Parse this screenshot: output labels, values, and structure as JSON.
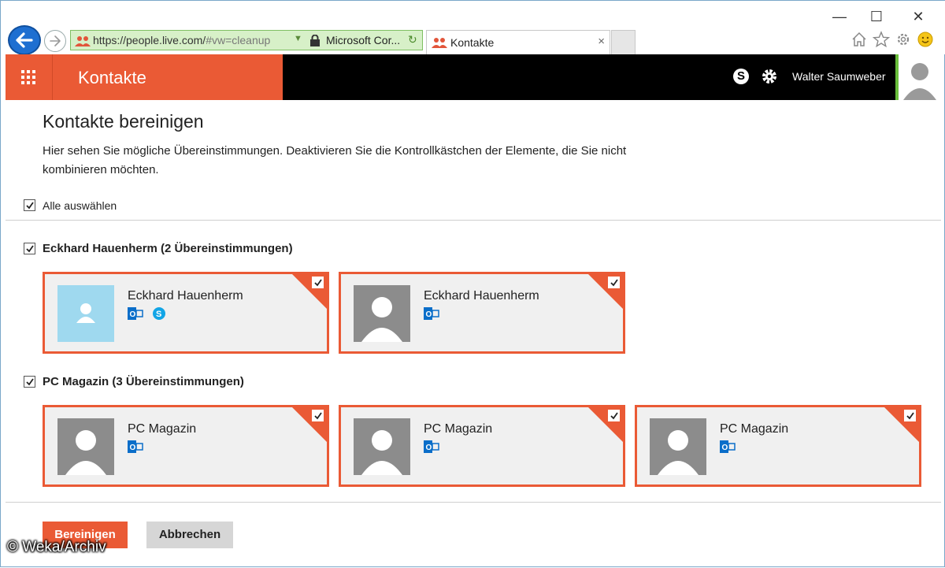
{
  "browser": {
    "url_main": "https://people.live.com/",
    "url_hash": "#vw=cleanup",
    "site_identity": "Microsoft Cor...",
    "tab_title": "Kontakte",
    "tab_close": "×",
    "window_controls": [
      "—",
      "☐",
      "✕"
    ],
    "icons": [
      "back-arrow-icon",
      "forward-arrow-icon",
      "people-icon",
      "lock-icon",
      "refresh-icon",
      "home-icon",
      "favorites-star-icon",
      "settings-gear-icon",
      "smiley-feedback-icon"
    ]
  },
  "appbar": {
    "title": "Kontakte",
    "user_name": "Walter Saumweber",
    "colors": {
      "brand": "#ea5a35",
      "bar": "#000000",
      "avatar_border": "#6abf3c"
    }
  },
  "page": {
    "title": "Kontakte bereinigen",
    "intro": "Hier sehen Sie mögliche Übereinstimmungen. Deaktivieren Sie die Kontrollkästchen der Elemente, die Sie nicht kombinieren möchten.",
    "select_all_label": "Alle auswählen",
    "select_all_checked": true
  },
  "groups": [
    {
      "label": "Eckhard Hauenherm (2 Übereinstimmungen)",
      "checked": true,
      "cards": [
        {
          "name": "Eckhard Hauenherm",
          "checked": true,
          "photo": "blue-placeholder",
          "services": [
            "outlook-icon",
            "skype-icon"
          ]
        },
        {
          "name": "Eckhard Hauenherm",
          "checked": true,
          "photo": "gray-silhouette",
          "services": [
            "outlook-icon"
          ]
        }
      ]
    },
    {
      "label": "PC Magazin (3 Übereinstimmungen)",
      "checked": true,
      "cards": [
        {
          "name": "PC Magazin",
          "checked": true,
          "photo": "gray-silhouette",
          "services": [
            "outlook-icon"
          ]
        },
        {
          "name": "PC Magazin",
          "checked": true,
          "photo": "gray-silhouette",
          "services": [
            "outlook-icon"
          ]
        },
        {
          "name": "PC Magazin",
          "checked": true,
          "photo": "gray-silhouette",
          "services": [
            "outlook-icon"
          ]
        }
      ]
    }
  ],
  "actions": {
    "primary": "Bereinigen",
    "secondary": "Abbrechen"
  },
  "watermark": "© Weka/Archiv"
}
